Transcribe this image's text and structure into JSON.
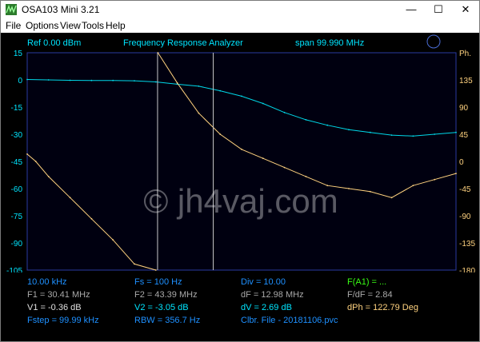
{
  "window": {
    "title": "OSA103 Mini 3.21",
    "minimize_glyph": "—",
    "maximize_glyph": "☐",
    "close_glyph": "✕"
  },
  "menu": [
    "File",
    "Options",
    "View",
    "Tools",
    "Help"
  ],
  "header": {
    "ref": "Ref  0.00 dBm",
    "title": "Frequency Response Analyzer",
    "span": "span 99.990 MHz"
  },
  "watermark": "© jh4vaj.com",
  "chart_data": {
    "type": "line",
    "x_range_mhz": [
      0.01,
      100.0
    ],
    "ylim_left": [
      -105,
      15
    ],
    "ylim_right": [
      -180,
      180
    ],
    "left_ticks": [
      "15",
      "0",
      "-15",
      "-30",
      "-45",
      "-60",
      "-75",
      "-90",
      "-105"
    ],
    "right_ticks": [
      "Ph.",
      "135",
      "90",
      "45",
      "0",
      "-45",
      "-90",
      "-135",
      "-180"
    ],
    "right_unit": "Ph.",
    "grid": false,
    "markers": [
      {
        "name": "F1",
        "x_mhz": 30.41
      },
      {
        "name": "F2",
        "x_mhz": 43.39
      }
    ],
    "series": [
      {
        "color": "#00d8e8",
        "axis": "left",
        "points": [
          [
            0.01,
            0.2
          ],
          [
            5,
            0
          ],
          [
            10,
            -0.2
          ],
          [
            15,
            -0.3
          ],
          [
            20,
            -0.3
          ],
          [
            25,
            -0.5
          ],
          [
            30,
            -1.1
          ],
          [
            35,
            -2.4
          ],
          [
            40,
            -3.5
          ],
          [
            45,
            -6
          ],
          [
            50,
            -9
          ],
          [
            55,
            -13
          ],
          [
            60,
            -18
          ],
          [
            65,
            -22
          ],
          [
            70,
            -25
          ],
          [
            75,
            -27.5
          ],
          [
            80,
            -29
          ],
          [
            85,
            -30.5
          ],
          [
            90,
            -31
          ],
          [
            95,
            -30
          ],
          [
            100,
            -29
          ]
        ]
      },
      {
        "color": "#ffd27f",
        "axis": "right",
        "points": [
          [
            0.01,
            12
          ],
          [
            2,
            0
          ],
          [
            5,
            -25
          ],
          [
            10,
            -60
          ],
          [
            15,
            -95
          ],
          [
            20,
            -130
          ],
          [
            25,
            -170
          ],
          [
            30,
            -180
          ],
          [
            30.5,
            180
          ],
          [
            35,
            130
          ],
          [
            40,
            80
          ],
          [
            45,
            45
          ],
          [
            50,
            20
          ],
          [
            55,
            5
          ],
          [
            60,
            -10
          ],
          [
            65,
            -25
          ],
          [
            70,
            -40
          ],
          [
            75,
            -45
          ],
          [
            80,
            -50
          ],
          [
            85,
            -60
          ],
          [
            90,
            -40
          ],
          [
            95,
            -30
          ],
          [
            100,
            -20
          ]
        ]
      }
    ]
  },
  "readouts": {
    "r1": {
      "c1": "10.00 kHz",
      "c2": "Fs = 100 Hz",
      "c3": "Div = 10.00",
      "c4": "F(A1) = ..."
    },
    "r2": {
      "c1": "F1 = 30.41 MHz",
      "c2": "F2 = 43.39 MHz",
      "c3": "dF = 12.98 MHz",
      "c4": "F/dF = 2.84"
    },
    "r3": {
      "c1": "V1 = -0.36 dB",
      "c2": "V2 = -3.05 dB",
      "c3": "dV = 2.69 dB",
      "c4": "dPh = 122.79 Deg"
    },
    "r4": {
      "c1": "Fstep = 99.99 kHz",
      "c2": "RBW = 356.7 Hz",
      "c3": "Clbr. File - 20181106.pvc",
      "c4": ""
    }
  }
}
